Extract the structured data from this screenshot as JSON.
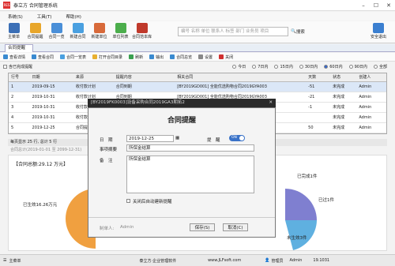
{
  "app": {
    "title": "泰立方 合同管理系统",
    "logo": "RES"
  },
  "menu": [
    "系统(S)",
    "工具(T)",
    "帮助(H)"
  ],
  "toolbar": [
    {
      "label": "主菜单",
      "color": "#3b6fb6"
    },
    {
      "label": "合同提醒",
      "color": "#e8a62a"
    },
    {
      "label": "合同一览",
      "color": "#4a8fd8"
    },
    {
      "label": "新建合同",
      "color": "#4aa0e0"
    },
    {
      "label": "新建单位",
      "color": "#d86a3a"
    },
    {
      "label": "单位列表",
      "color": "#4cae4c"
    },
    {
      "label": "合同范本库",
      "color": "#c0392b"
    }
  ],
  "search": {
    "placeholder": "编号 名称 单位 联系人 标签 部门 业务员 项目",
    "button": "搜索"
  },
  "exit_label": "安全退出",
  "tab": "合同提醒",
  "subtoolbar": [
    {
      "label": "查看详情",
      "color": "#3a8ad0"
    },
    {
      "label": "查看合同",
      "color": "#3a8ad0"
    },
    {
      "label": "合同一览表",
      "color": "#4aa0e0"
    },
    {
      "label": "打开合同目录",
      "color": "#e8b030"
    },
    {
      "label": "刷新",
      "color": "#3aa050"
    },
    {
      "label": "输出",
      "color": "#3a8ad0"
    },
    {
      "label": "合同总览",
      "color": "#3a8ad0"
    },
    {
      "label": "设置",
      "color": "#888888"
    },
    {
      "label": "关闭",
      "color": "#d03030"
    }
  ],
  "filter": {
    "show_done": "含已完成提醒",
    "ranges": [
      "今日",
      "7日内",
      "15日内",
      "30日内",
      "60日内",
      "90日内",
      "全部"
    ],
    "selected": "60日内"
  },
  "table": {
    "headers": [
      "行号",
      "日期",
      "来源",
      "提醒内容",
      "相关合同",
      "天数",
      "状态",
      "创建人"
    ],
    "rows": [
      [
        "1",
        "2019-09-15",
        "收付款计划",
        "合同到期",
        "[BY2019GD001] 全能优选购物合同2019GYA003",
        "-51",
        "未完成",
        "Admin"
      ],
      [
        "2",
        "2019-10-31",
        "收付款计划",
        "合同到期",
        "[BY2019GD001] 全能优选购物合同2019GYA003",
        "-21",
        "未完成",
        "Admin"
      ],
      [
        "3",
        "2019-10-31",
        "收付款计划",
        "合同到期",
        "[BY2019GD001] 全能优选购物合同2019GYA003",
        "-1",
        "未完成",
        "Admin"
      ],
      [
        "4",
        "2019-10-31",
        "收付款计",
        "",
        "",
        "",
        "未完成",
        "Admin"
      ],
      [
        "5",
        "2019-12-25",
        "合同提",
        "",
        "",
        "50",
        "未完成",
        "Admin"
      ]
    ]
  },
  "status": {
    "page_info": "每页显示 25 行, 总计 5 行",
    "summary": "合同总计(2019-01-01 至 2099-12-31)"
  },
  "chart_data": {
    "type": "pie",
    "title": "【合同总额:29.12 万元】",
    "slices": [
      {
        "label": "已生效16.26万元",
        "value": 16.26,
        "color": "#f0a040"
      },
      {
        "label": "已完成1件",
        "value": 1,
        "color": "#7f7fd0"
      },
      {
        "label": "已过1件",
        "value": 1,
        "color": "#5fb0e0"
      },
      {
        "label": "未生效3件",
        "value": 3,
        "color": "#c0d0e0"
      }
    ]
  },
  "bottom": {
    "menu": "主菜单",
    "center": "泰立方·企业管理软件",
    "site": "www.JLFsoft.com",
    "user": "管理员",
    "role": "Admin",
    "version": "19.1031"
  },
  "dialog": {
    "window_title": "[BY2019FK0003]设备采购合同2019GA3期拓2",
    "heading": "合同提醒",
    "date_label": "日　期",
    "date_value": "2019-12-25",
    "remind_label": "提　醒",
    "toggle": "ON",
    "summary_label": "事项摘要",
    "summary_value": "所保金结算",
    "note_label": "备　注",
    "note_value": "所保金结算",
    "auto_close": "关闭后自动建新提醒",
    "creator_label": "制单人:",
    "creator_value": "Admin",
    "save": "保存(S)",
    "cancel": "取消(C)"
  }
}
